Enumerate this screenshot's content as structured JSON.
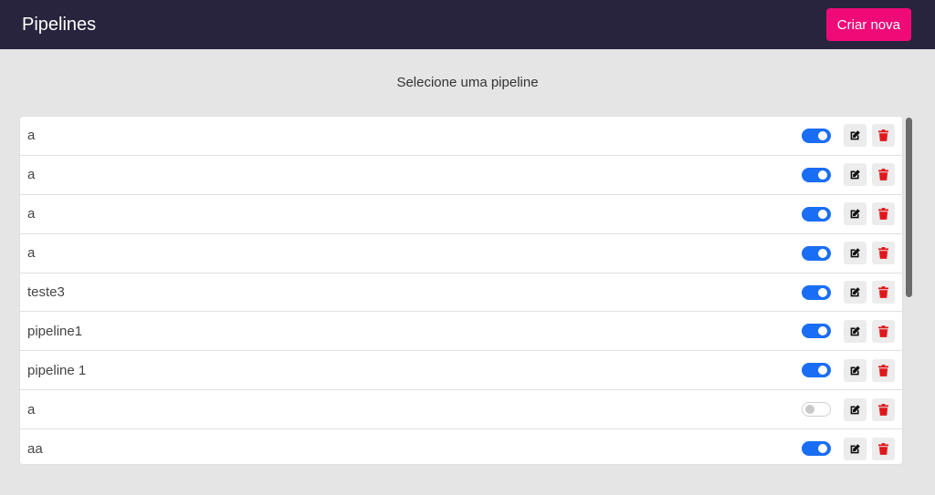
{
  "header": {
    "title": "Pipelines",
    "create_label": "Criar nova"
  },
  "main": {
    "subtitle": "Selecione uma pipeline"
  },
  "pipelines": [
    {
      "name": "a",
      "active": true
    },
    {
      "name": "a",
      "active": true
    },
    {
      "name": "a",
      "active": true
    },
    {
      "name": "a",
      "active": true
    },
    {
      "name": "teste3",
      "active": true
    },
    {
      "name": "pipeline1",
      "active": true
    },
    {
      "name": "pipeline 1",
      "active": true
    },
    {
      "name": "a",
      "active": false
    },
    {
      "name": "aa",
      "active": true
    }
  ],
  "icons": {
    "edit": "edit-icon",
    "delete": "trash-icon"
  },
  "colors": {
    "header_bg": "#28243d",
    "accent": "#f00a78",
    "toggle_on": "#1a6ef5",
    "delete": "#e0181b"
  }
}
